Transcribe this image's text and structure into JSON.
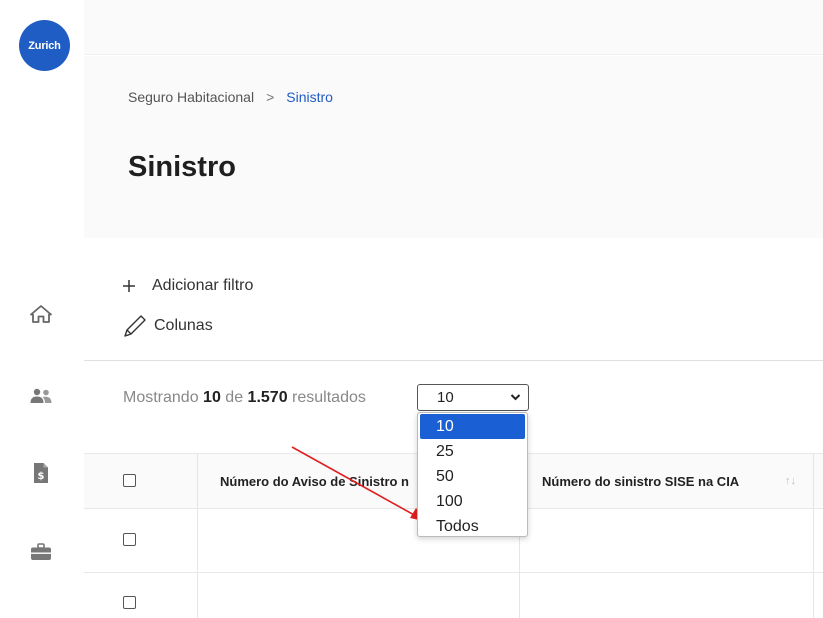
{
  "brand": {
    "logo_text": "Zurich",
    "color": "#1f5cc4"
  },
  "sidebar": {
    "items": [
      {
        "icon": "home-icon"
      },
      {
        "icon": "users-icon"
      },
      {
        "icon": "document-dollar-icon"
      },
      {
        "icon": "briefcase-icon"
      }
    ]
  },
  "breadcrumb": {
    "parent": "Seguro Habitacional",
    "separator": ">",
    "current": "Sinistro"
  },
  "page": {
    "title": "Sinistro"
  },
  "actions": {
    "add_filter": "Adicionar filtro",
    "columns": "Colunas"
  },
  "results": {
    "prefix": "Mostrando",
    "shown": "10",
    "of": "de",
    "total": "1.570",
    "suffix": "resultados"
  },
  "page_size_select": {
    "value": "10",
    "options": [
      "10",
      "25",
      "50",
      "100",
      "Todos"
    ],
    "selected_color": "#1a5fd4"
  },
  "table": {
    "columns": [
      {
        "label": "Número do Aviso de Sinistro n"
      },
      {
        "label": "Número do sinistro SISE na CIA",
        "sort_icon": "↑↓"
      }
    ]
  },
  "annotation": {
    "arrow_color": "#e02020",
    "points_to": "Todos"
  }
}
